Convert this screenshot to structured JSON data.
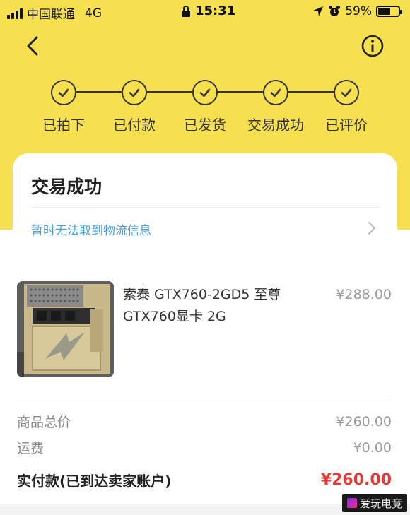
{
  "status_bar": {
    "carrier": "中国联通",
    "network": "4G",
    "time": "15:31",
    "battery": "59%",
    "battery_level": 0.59
  },
  "header": {
    "back_icon": "chevron-left-icon",
    "info_icon": "info-circle-icon"
  },
  "steps": [
    {
      "label": "已拍下",
      "done": true
    },
    {
      "label": "已付款",
      "done": true
    },
    {
      "label": "已发货",
      "done": true
    },
    {
      "label": "交易成功",
      "done": true
    },
    {
      "label": "已评价",
      "done": true
    }
  ],
  "status_card": {
    "title": "交易成功",
    "logistics_text": "暂时无法取到物流信息"
  },
  "product": {
    "name": "索泰 GTX760-2GD5 至尊 GTX760显卡 2G",
    "price": "¥288.00"
  },
  "summary": {
    "goods_total_label": "商品总价",
    "goods_total_value": "¥260.00",
    "shipping_label": "运费",
    "shipping_value": "¥0.00",
    "paid_label": "实付款(已到达卖家账户)",
    "paid_value": "¥260.00"
  },
  "watermark": {
    "text": "爱玩电竞"
  },
  "colors": {
    "accent_yellow": "#f7e04f",
    "link_blue": "#4a9fe0",
    "price_red": "#e53935"
  }
}
